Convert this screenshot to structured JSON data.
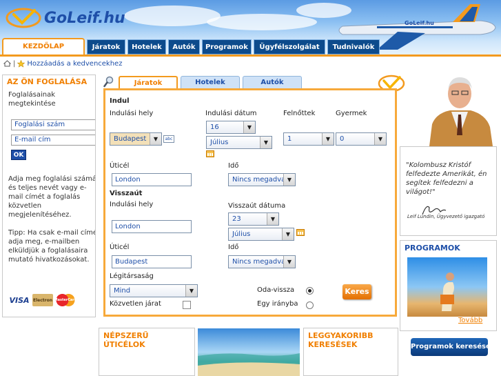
{
  "brand": {
    "name": "GoLeif",
    "tld": ".hu",
    "plane_text": "GoLeif.hu"
  },
  "nav": {
    "home": "KEZDŐLAP",
    "items": [
      "Járatok",
      "Hotelek",
      "Autók",
      "Programok",
      "Ügyfélszolgálat",
      "Tudnivalók"
    ]
  },
  "breadcrumb": {
    "separator": "|",
    "favorites": "Hozzáadás a kedvencekhez"
  },
  "booking": {
    "title": "AZ ÖN FOGLALÁSA",
    "intro": [
      "Foglalásainak",
      "megtekintése"
    ],
    "booking_number_placeholder": "Foglalási szám",
    "email_placeholder": "E-mail cím",
    "ok": "OK",
    "help": [
      "Adja meg foglalási számát",
      "és teljes nevét vagy e-",
      "mail címét a foglalás",
      "közvetlen",
      "megjelenítéséhez."
    ],
    "tip": [
      "Tipp: Ha csak e-mail címét",
      "adja meg, e-mailben",
      "elküldjük a foglalásaira",
      "mutató hivatkozásokat."
    ],
    "cards": [
      "VISA",
      "Electron",
      "MasterCard"
    ]
  },
  "search": {
    "tabs": [
      "Járatok",
      "Hotelek",
      "Autók"
    ],
    "indul": {
      "heading": "Indul",
      "from_label": "Indulási hely",
      "from_value": "Budapest",
      "abc": "abc",
      "date_label": "Indulási dátum",
      "day": "16",
      "month": "Július",
      "adults_label": "Felnőttek",
      "adults": "1",
      "children_label": "Gyermek",
      "children": "0",
      "to_label": "Úticél",
      "to_value": "London",
      "time_label": "Idő",
      "time_value": "Nincs megadva"
    },
    "vissza": {
      "heading": "Visszaút",
      "from_label": "Indulási hely",
      "from_value": "London",
      "date_label": "Visszaút dátuma",
      "day": "23",
      "month": "Július",
      "to_label": "Úticél",
      "to_value": "Budapest",
      "time_label": "Idő",
      "time_value": "Nincs megadva"
    },
    "airline_label": "Légitársaság",
    "airline_value": "Mind",
    "direct_label": "Közvetlen járat",
    "roundtrip_label": "Oda-vissza",
    "oneway_label": "Egy irányba",
    "roundtrip_selected": true,
    "submit": "Keres"
  },
  "quote": {
    "text": "\"Kolombusz Kristóf felfedezte Amerikát, én segítek felfedezni a világot!\"",
    "signature": "Leif Lundin, Ügyvezető igazgató"
  },
  "programs": {
    "title": "PROGRAMOK",
    "more": "Tovább",
    "button": "Programok keresése"
  },
  "popular": {
    "title_line1": "NÉPSZERŰ",
    "title_line2": "ÚTICÉLOK"
  },
  "frequent": {
    "title_line1": "LEGGYAKORIBB",
    "title_line2": "KERESÉSEK"
  }
}
